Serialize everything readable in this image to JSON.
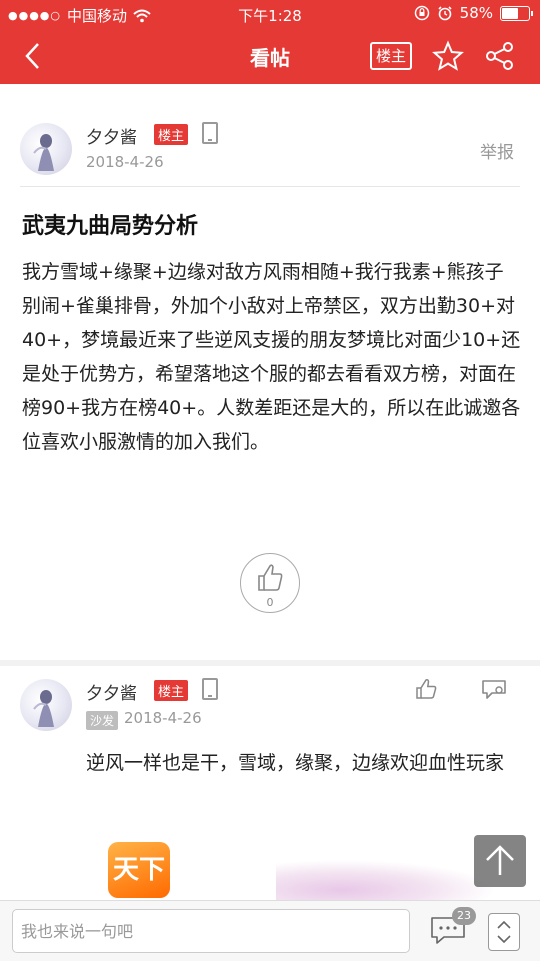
{
  "status_bar": {
    "carrier": "中国移动",
    "time": "下午1:28",
    "battery": "58%",
    "battery_level": 0.58
  },
  "nav": {
    "title": "看帖",
    "owner_label": "楼主"
  },
  "post": {
    "author": "夕夕酱",
    "badge": "楼主",
    "date": "2018-4-26",
    "report": "举报",
    "title": "武夷九曲局势分析",
    "body": "我方雪域+缘聚+边缘对敌方风雨相随+我行我素+熊孩子别闹+雀巢排骨，外加个小敌对上帝禁区，双方出勤30+对40+，梦境最近来了些逆风支援的朋友梦境比对面少10+还是处于优势方，希望落地这个服的都去看看双方榜，对面在榜90+我方在榜40+。人数差距还是大的，所以在此诚邀各位喜欢小服激情的加入我们。",
    "likes": "0"
  },
  "reply": {
    "author": "夕夕酱",
    "badge": "楼主",
    "floor": "沙发",
    "date": "2018-4-26",
    "body": "逆风一样也是干，雪域，缘聚，边缘欢迎血性玩家",
    "image_logo_text": "天下"
  },
  "bottom": {
    "placeholder": "我也来说一句吧",
    "comment_count": "23"
  }
}
